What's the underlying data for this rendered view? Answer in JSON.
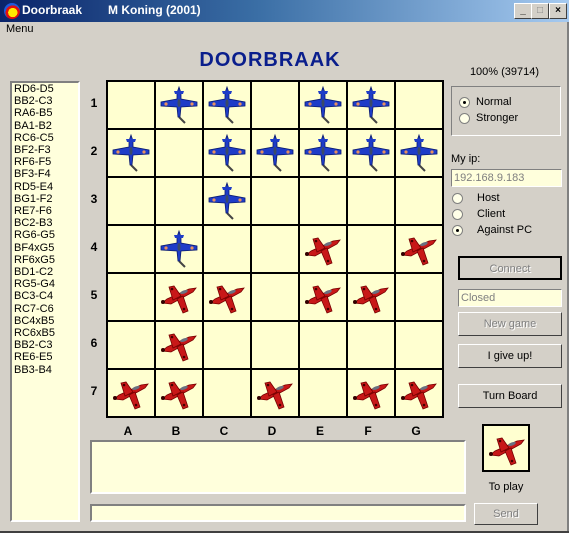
{
  "window": {
    "title": "Doorbraak",
    "subtitle": "M Koning (2001)",
    "minimize": "_",
    "maximize": "□",
    "close": "×"
  },
  "menu": {
    "label": "Menu"
  },
  "heading": "DOORBRAAK",
  "progress_text": "100% (39714)",
  "difficulty": {
    "options": [
      {
        "label": "Normal",
        "selected": true
      },
      {
        "label": "Stronger",
        "selected": false
      }
    ]
  },
  "network": {
    "my_ip_label": "My ip:",
    "ip_value": "192.168.9.183",
    "modes": [
      {
        "label": "Host",
        "selected": false
      },
      {
        "label": "Client",
        "selected": false
      },
      {
        "label": "Against PC",
        "selected": true
      }
    ],
    "status_value": "Closed"
  },
  "buttons": {
    "connect": "Connect",
    "new_game": "New game",
    "give_up": "I give up!",
    "turn_board": "Turn Board",
    "send": "Send"
  },
  "to_play": {
    "label": "To play",
    "piece": "red"
  },
  "moves": [
    "RD6-D5",
    "BB2-C3",
    "RA6-B5",
    "BA1-B2",
    "RC6-C5",
    "BF2-F3",
    "RF6-F5",
    "BF3-F4",
    "RD5-E4",
    "BG1-F2",
    "RE7-F6",
    "BC2-B3",
    "RG6-G5",
    "BF4xG5",
    "RF6xG5",
    "BD1-C2",
    "RG5-G4",
    "BC3-C4",
    "RC7-C6",
    "BC4xB5",
    "RC6xB5",
    "BB2-C3",
    "RE6-E5",
    "BB3-B4"
  ],
  "board": {
    "columns": [
      "A",
      "B",
      "C",
      "D",
      "E",
      "F",
      "G"
    ],
    "rows": [
      "1",
      "2",
      "3",
      "4",
      "5",
      "6",
      "7"
    ],
    "cells": [
      [
        "",
        "blue",
        "blue",
        "",
        "blue",
        "blue",
        ""
      ],
      [
        "blue",
        "",
        "blue",
        "blue",
        "blue",
        "blue",
        "blue"
      ],
      [
        "",
        "",
        "blue",
        "",
        "",
        "",
        ""
      ],
      [
        "",
        "blue",
        "",
        "",
        "red",
        "",
        "red"
      ],
      [
        "",
        "red",
        "red",
        "",
        "red",
        "red",
        ""
      ],
      [
        "",
        "red",
        "",
        "",
        "",
        "",
        ""
      ],
      [
        "red",
        "red",
        "",
        "red",
        "",
        "red",
        "red"
      ]
    ]
  },
  "chat": {
    "log": "",
    "input": ""
  },
  "colors": {
    "blue_plane": "#1e3cc8",
    "red_plane": "#c81818",
    "board_cell": "#ffffd0",
    "heading": "#0a1e8c"
  }
}
